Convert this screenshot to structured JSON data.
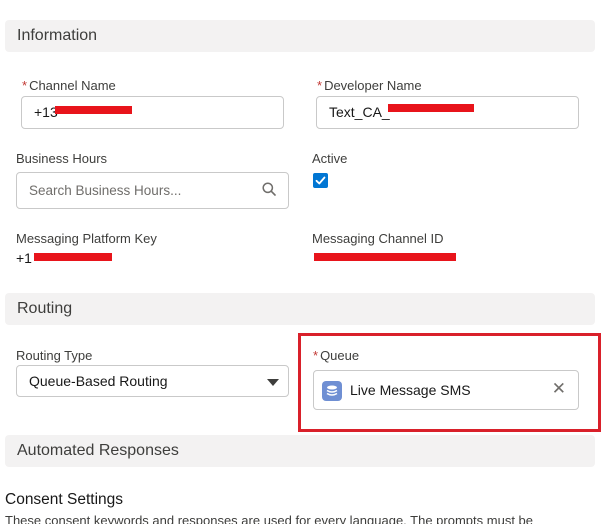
{
  "sections": {
    "information": "Information",
    "routing": "Routing",
    "automated_responses": "Automated Responses"
  },
  "fields": {
    "channel_name": {
      "label": "Channel Name",
      "required_mark": "*",
      "value": "+13"
    },
    "developer_name": {
      "label": "Developer Name",
      "required_mark": "*",
      "value": "Text_CA_"
    },
    "business_hours": {
      "label": "Business Hours",
      "placeholder": "Search Business Hours..."
    },
    "active": {
      "label": "Active",
      "checked": true
    },
    "messaging_platform_key": {
      "label": "Messaging Platform Key",
      "value": "+1"
    },
    "messaging_channel_id": {
      "label": "Messaging Channel ID",
      "value": ""
    },
    "routing_type": {
      "label": "Routing Type",
      "value": "Queue-Based Routing"
    },
    "queue": {
      "label": "Queue",
      "required_mark": "*",
      "value": "Live Message SMS"
    }
  },
  "consent": {
    "title": "Consent Settings",
    "description": "These consent keywords and responses are used for every language. The prompts must be"
  },
  "colors": {
    "accent": "#0176d3",
    "required": "#c23934",
    "redaction": "#e8141b",
    "highlight": "#d9202a"
  },
  "icons": {
    "search": "search-icon",
    "checkbox": "checkmark-icon",
    "queue": "queue-stack-icon",
    "close": "close-icon",
    "dropdown": "chevron-down-icon"
  }
}
